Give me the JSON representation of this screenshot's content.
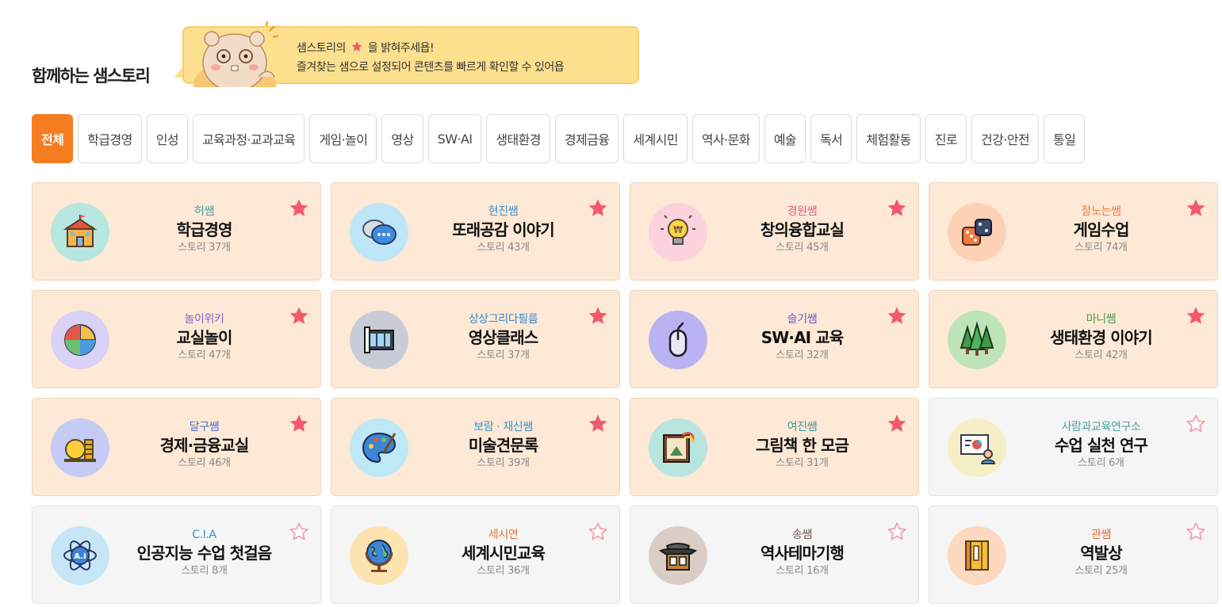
{
  "header": {
    "title": "함께하는 샘스토리",
    "banner_line1_a": "샘스토리의",
    "banner_line1_b": "을 밝혀주세욥!",
    "banner_line2": "즐겨찾는 샘으로 설정되어 콘텐츠를 빠르게 확인할 수 있어욥"
  },
  "tabs": [
    {
      "label": "전체",
      "active": true
    },
    {
      "label": "학급경영"
    },
    {
      "label": "인성"
    },
    {
      "label": "교육과정·교과교육"
    },
    {
      "label": "게임·놀이"
    },
    {
      "label": "영상"
    },
    {
      "label": "SW·AI"
    },
    {
      "label": "생태환경"
    },
    {
      "label": "경제금융"
    },
    {
      "label": "세계시민"
    },
    {
      "label": "역사·문화"
    },
    {
      "label": "예술"
    },
    {
      "label": "독서"
    },
    {
      "label": "체험활동"
    },
    {
      "label": "진로"
    },
    {
      "label": "건강·안전"
    },
    {
      "label": "통일"
    }
  ],
  "colors": {
    "accent": "#f57c1f",
    "star_filled": "#f25a6b",
    "star_empty": "#f2a1aa",
    "card_peach": "#fde9d6",
    "card_gray": "#f5f5f5"
  },
  "cards": [
    {
      "author": "허쌤",
      "title": "학급경영",
      "count": "스토리 37개",
      "favorite": true,
      "icon": "school-building-icon",
      "icon_bg": "#b6e6df",
      "author_color": "#4a9ea3"
    },
    {
      "author": "현진쌤",
      "title": "또래공감 이야기",
      "count": "스토리 43개",
      "favorite": true,
      "icon": "chat-bubbles-icon",
      "icon_bg": "#bfe6f6",
      "author_color": "#3f8fd0"
    },
    {
      "author": "경원쌤",
      "title": "창의융합교실",
      "count": "스토리 45개",
      "favorite": true,
      "icon": "lightbulb-icon",
      "icon_bg": "#fbd2de",
      "author_color": "#e0608a"
    },
    {
      "author": "잘노는쌤",
      "title": "게임수업",
      "count": "스토리 74개",
      "favorite": true,
      "icon": "dice-icon",
      "icon_bg": "#fcd1b6",
      "author_color": "#ef7b3d"
    },
    {
      "author": "놀이위키",
      "title": "교실놀이",
      "count": "스토리 47개",
      "favorite": true,
      "icon": "puzzle-icon",
      "icon_bg": "#d9d2f6",
      "author_color": "#8a5fc8"
    },
    {
      "author": "상상그리다필름",
      "title": "영상클래스",
      "count": "스토리 37개",
      "favorite": true,
      "icon": "film-reel-icon",
      "icon_bg": "#c8ccd6",
      "author_color": "#3c8ac8"
    },
    {
      "author": "슬기쌤",
      "title": "SW·AI 교육",
      "count": "스토리 32개",
      "favorite": true,
      "icon": "mouse-icon",
      "icon_bg": "#b9b3f3",
      "author_color": "#6f55d6"
    },
    {
      "author": "마니쌤",
      "title": "생태환경 이야기",
      "count": "스토리 42개",
      "favorite": true,
      "icon": "trees-icon",
      "icon_bg": "#bfe3b9",
      "author_color": "#4e9a4b"
    },
    {
      "author": "달구쌤",
      "title": "경제·금융교실",
      "count": "스토리 46개",
      "favorite": true,
      "icon": "coins-icon",
      "icon_bg": "#c5cbf5",
      "author_color": "#4f6fcf"
    },
    {
      "author": "보람 · 재신쌤",
      "title": "미술견문록",
      "count": "스토리 39개",
      "favorite": true,
      "icon": "palette-icon",
      "icon_bg": "#bde8f6",
      "author_color": "#3594cc"
    },
    {
      "author": "여진쌤",
      "title": "그림책 한 모금",
      "count": "스토리 31개",
      "favorite": true,
      "icon": "picture-book-icon",
      "icon_bg": "#b9e5df",
      "author_color": "#3e9c95"
    },
    {
      "author": "사람과교육연구소",
      "title": "수업 실천 연구",
      "count": "스토리 6개",
      "favorite": false,
      "gray": true,
      "icon": "presentation-icon",
      "icon_bg": "#f6eec4",
      "author_color": "#4aa19c"
    },
    {
      "author": "C.I.A",
      "title": "인공지능 수업 첫걸음",
      "count": "스토리 8개",
      "favorite": false,
      "gray": true,
      "icon": "ai-atom-icon",
      "icon_bg": "#c6e6f6",
      "author_color": "#3a8fd1"
    },
    {
      "author": "세시연",
      "title": "세계시민교육",
      "count": "스토리 36개",
      "favorite": false,
      "gray": true,
      "icon": "globe-icon",
      "icon_bg": "#fde3b0",
      "author_color": "#e0783a"
    },
    {
      "author": "송쌤",
      "title": "역사테마기행",
      "count": "스토리 16개",
      "favorite": false,
      "gray": true,
      "icon": "hanok-gate-icon",
      "icon_bg": "#d9cdc6",
      "author_color": "#6e5a4e"
    },
    {
      "author": "관쌤",
      "title": "역발상",
      "count": "스토리 25개",
      "favorite": false,
      "gray": true,
      "icon": "notebook-icon",
      "icon_bg": "#fdd9c0",
      "author_color": "#e06a30"
    }
  ]
}
